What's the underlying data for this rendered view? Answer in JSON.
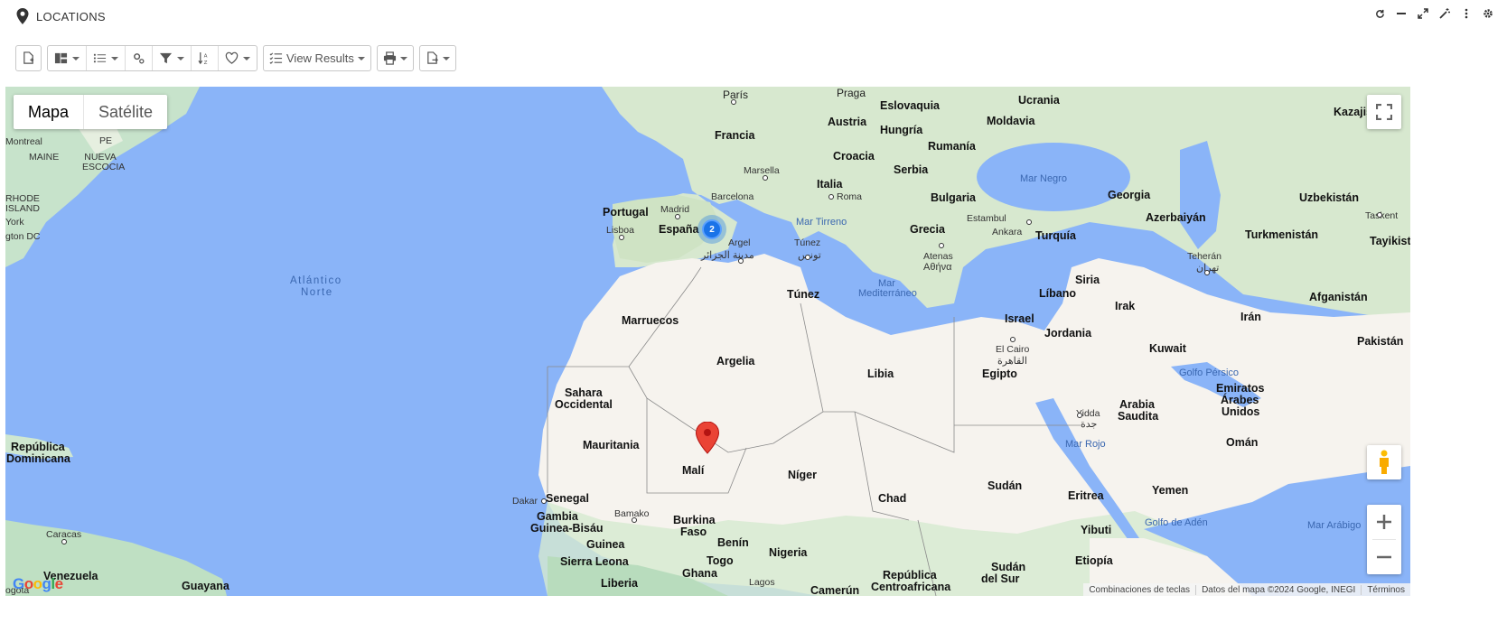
{
  "header": {
    "title": "LOCATIONS",
    "actions": [
      "refresh-icon",
      "minimize-icon",
      "expand-icon",
      "magic-wand-icon",
      "more-vert-icon",
      "settings-icon"
    ]
  },
  "toolbar": {
    "view_results_label": "View Results"
  },
  "map": {
    "type_options": {
      "map": "Mapa",
      "satellite": "Satélite"
    },
    "cluster_count": "2",
    "attribution": {
      "shortcuts": "Combinaciones de teclas",
      "data": "Datos del mapa ©2024 Google, INEGI",
      "terms": "Términos"
    },
    "logo": "Google",
    "labels": {
      "paris": "París",
      "praga": "Praga",
      "eslovaquia": "Eslovaquia",
      "ucrania": "Ucrania",
      "kazajistan": "Kazajis",
      "austria": "Austria",
      "moldavia": "Moldavia",
      "francia": "Francia",
      "hungria": "Hungría",
      "rumania": "Rumanía",
      "croacia": "Croacia",
      "serbia": "Serbia",
      "marsella": "Marsella",
      "italia": "Italia",
      "roma": "Roma",
      "bulgaria": "Bulgaria",
      "mar_negro": "Mar Negro",
      "georgia": "Georgia",
      "uzbekistan": "Uzbekistán",
      "barcelona": "Barcelona",
      "portugal": "Portugal",
      "madrid": "Madrid",
      "espana": "España",
      "lisboa": "Lisboa",
      "mar_tirreno": "Mar Tirreno",
      "estambul": "Estambul",
      "ankara": "Ankara",
      "turquia": "Turquía",
      "azerbaiyan": "Azerbaiyán",
      "turkmenistan": "Turkmenistán",
      "tashkent": "Taskent",
      "tayikistan": "Tayikist",
      "argel": "Argel",
      "argel_ar": "مدينة الجزائر",
      "tunez_city": "Túnez",
      "tunez_ar": "تونس",
      "grecia": "Grecia",
      "atenas": "Atenas",
      "atenas_gr": "Αθήνα",
      "teheran": "Teherán",
      "teheran_ar": "تهران",
      "montreal": "Montreal",
      "pe": "PE",
      "maine": "MAINE",
      "nueva_escocia": "NUEVA ESCOCIA",
      "rhode": "RHODE",
      "island": "ISLAND",
      "york": "York",
      "dc": "gton DC",
      "atlantico": "Atlántico",
      "norte": "Norte",
      "tunez": "Túnez",
      "mar_med": "Mar",
      "mar_med2": "Mediterráneo",
      "siria": "Siria",
      "libano": "Líbano",
      "afganistan": "Afganistán",
      "irak": "Irak",
      "iran": "Irán",
      "israel": "Israel",
      "jordania": "Jordania",
      "marruecos": "Marruecos",
      "pakistan": "Pakistán",
      "kuwait": "Kuwait",
      "el_cairo": "El Cairo",
      "cairo_ar": "القاهرة",
      "argelia": "Argelia",
      "libia": "Libia",
      "egipto": "Egipto",
      "golfo_persico": "Golfo Pérsico",
      "emiratos": "Emiratos",
      "arabes": "Árabes",
      "unidos": "Unidos",
      "sahara": "Sahara",
      "occidental": "Occidental",
      "yidda": "Yidda",
      "yidda_ar": "جدة",
      "arabia": "Arabia",
      "saudita": "Saudita",
      "rep_dom": "República",
      "dominicana": "Dominicana",
      "mauritania": "Mauritania",
      "omán": "Omán",
      "mar_rojo": "Mar Rojo",
      "mali": "Malí",
      "niger": "Níger",
      "chad": "Chad",
      "sudan": "Sudán",
      "eritrea": "Eritrea",
      "yemen": "Yemen",
      "dakar": "Dakar",
      "senegal": "Senegal",
      "gambia": "Gambia",
      "guinea_bisau": "Guinea-Bisáu",
      "bamako": "Bamako",
      "burkina": "Burkina",
      "faso": "Faso",
      "yibuti": "Yibuti",
      "golfo_aden": "Golfo de Adén",
      "mar_arabigo": "Mar Arábigo",
      "caracas": "Caracas",
      "guinea": "Guinea",
      "benin": "Benín",
      "nigeria": "Nigeria",
      "sierra_leona": "Sierra Leona",
      "togo": "Togo",
      "sudan_sur": "Sudán",
      "del_sur": "del Sur",
      "etiopia": "Etiopía",
      "venezuela": "Venezuela",
      "guayana": "Guayana",
      "liberia": "Liberia",
      "ghana": "Ghana",
      "lagos": "Lagos",
      "rep_centro": "República",
      "centroafricana": "Centroafricana",
      "camerun": "Camerún",
      "bogota": "ogota"
    }
  },
  "colors": {
    "water": "#8ab4f8",
    "land": "#f5f3ef",
    "green": "#bfe3c6",
    "cluster": "#1a73e8",
    "marker": "#ea4335"
  }
}
